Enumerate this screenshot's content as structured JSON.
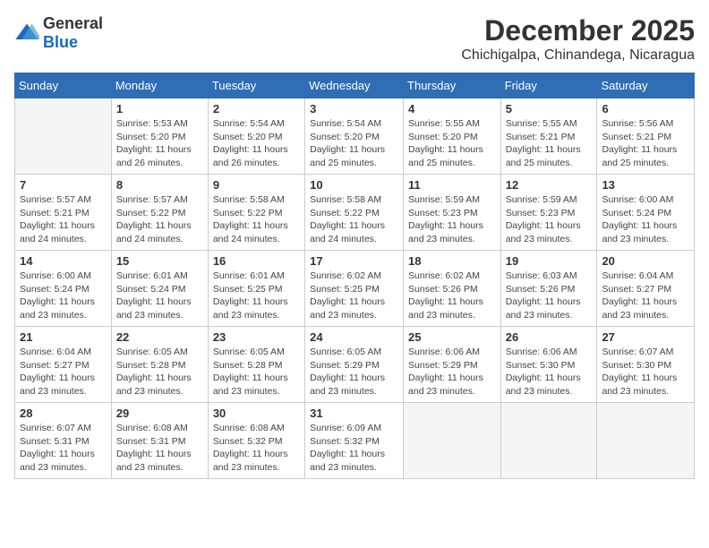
{
  "logo": {
    "general": "General",
    "blue": "Blue"
  },
  "title": "December 2025",
  "location": "Chichigalpa, Chinandega, Nicaragua",
  "headers": [
    "Sunday",
    "Monday",
    "Tuesday",
    "Wednesday",
    "Thursday",
    "Friday",
    "Saturday"
  ],
  "weeks": [
    [
      {
        "day": "",
        "info": ""
      },
      {
        "day": "1",
        "info": "Sunrise: 5:53 AM\nSunset: 5:20 PM\nDaylight: 11 hours\nand 26 minutes."
      },
      {
        "day": "2",
        "info": "Sunrise: 5:54 AM\nSunset: 5:20 PM\nDaylight: 11 hours\nand 26 minutes."
      },
      {
        "day": "3",
        "info": "Sunrise: 5:54 AM\nSunset: 5:20 PM\nDaylight: 11 hours\nand 25 minutes."
      },
      {
        "day": "4",
        "info": "Sunrise: 5:55 AM\nSunset: 5:20 PM\nDaylight: 11 hours\nand 25 minutes."
      },
      {
        "day": "5",
        "info": "Sunrise: 5:55 AM\nSunset: 5:21 PM\nDaylight: 11 hours\nand 25 minutes."
      },
      {
        "day": "6",
        "info": "Sunrise: 5:56 AM\nSunset: 5:21 PM\nDaylight: 11 hours\nand 25 minutes."
      }
    ],
    [
      {
        "day": "7",
        "info": "Sunrise: 5:57 AM\nSunset: 5:21 PM\nDaylight: 11 hours\nand 24 minutes."
      },
      {
        "day": "8",
        "info": "Sunrise: 5:57 AM\nSunset: 5:22 PM\nDaylight: 11 hours\nand 24 minutes."
      },
      {
        "day": "9",
        "info": "Sunrise: 5:58 AM\nSunset: 5:22 PM\nDaylight: 11 hours\nand 24 minutes."
      },
      {
        "day": "10",
        "info": "Sunrise: 5:58 AM\nSunset: 5:22 PM\nDaylight: 11 hours\nand 24 minutes."
      },
      {
        "day": "11",
        "info": "Sunrise: 5:59 AM\nSunset: 5:23 PM\nDaylight: 11 hours\nand 23 minutes."
      },
      {
        "day": "12",
        "info": "Sunrise: 5:59 AM\nSunset: 5:23 PM\nDaylight: 11 hours\nand 23 minutes."
      },
      {
        "day": "13",
        "info": "Sunrise: 6:00 AM\nSunset: 5:24 PM\nDaylight: 11 hours\nand 23 minutes."
      }
    ],
    [
      {
        "day": "14",
        "info": "Sunrise: 6:00 AM\nSunset: 5:24 PM\nDaylight: 11 hours\nand 23 minutes."
      },
      {
        "day": "15",
        "info": "Sunrise: 6:01 AM\nSunset: 5:24 PM\nDaylight: 11 hours\nand 23 minutes."
      },
      {
        "day": "16",
        "info": "Sunrise: 6:01 AM\nSunset: 5:25 PM\nDaylight: 11 hours\nand 23 minutes."
      },
      {
        "day": "17",
        "info": "Sunrise: 6:02 AM\nSunset: 5:25 PM\nDaylight: 11 hours\nand 23 minutes."
      },
      {
        "day": "18",
        "info": "Sunrise: 6:02 AM\nSunset: 5:26 PM\nDaylight: 11 hours\nand 23 minutes."
      },
      {
        "day": "19",
        "info": "Sunrise: 6:03 AM\nSunset: 5:26 PM\nDaylight: 11 hours\nand 23 minutes."
      },
      {
        "day": "20",
        "info": "Sunrise: 6:04 AM\nSunset: 5:27 PM\nDaylight: 11 hours\nand 23 minutes."
      }
    ],
    [
      {
        "day": "21",
        "info": "Sunrise: 6:04 AM\nSunset: 5:27 PM\nDaylight: 11 hours\nand 23 minutes."
      },
      {
        "day": "22",
        "info": "Sunrise: 6:05 AM\nSunset: 5:28 PM\nDaylight: 11 hours\nand 23 minutes."
      },
      {
        "day": "23",
        "info": "Sunrise: 6:05 AM\nSunset: 5:28 PM\nDaylight: 11 hours\nand 23 minutes."
      },
      {
        "day": "24",
        "info": "Sunrise: 6:05 AM\nSunset: 5:29 PM\nDaylight: 11 hours\nand 23 minutes."
      },
      {
        "day": "25",
        "info": "Sunrise: 6:06 AM\nSunset: 5:29 PM\nDaylight: 11 hours\nand 23 minutes."
      },
      {
        "day": "26",
        "info": "Sunrise: 6:06 AM\nSunset: 5:30 PM\nDaylight: 11 hours\nand 23 minutes."
      },
      {
        "day": "27",
        "info": "Sunrise: 6:07 AM\nSunset: 5:30 PM\nDaylight: 11 hours\nand 23 minutes."
      }
    ],
    [
      {
        "day": "28",
        "info": "Sunrise: 6:07 AM\nSunset: 5:31 PM\nDaylight: 11 hours\nand 23 minutes."
      },
      {
        "day": "29",
        "info": "Sunrise: 6:08 AM\nSunset: 5:31 PM\nDaylight: 11 hours\nand 23 minutes."
      },
      {
        "day": "30",
        "info": "Sunrise: 6:08 AM\nSunset: 5:32 PM\nDaylight: 11 hours\nand 23 minutes."
      },
      {
        "day": "31",
        "info": "Sunrise: 6:09 AM\nSunset: 5:32 PM\nDaylight: 11 hours\nand 23 minutes."
      },
      {
        "day": "",
        "info": ""
      },
      {
        "day": "",
        "info": ""
      },
      {
        "day": "",
        "info": ""
      }
    ]
  ]
}
